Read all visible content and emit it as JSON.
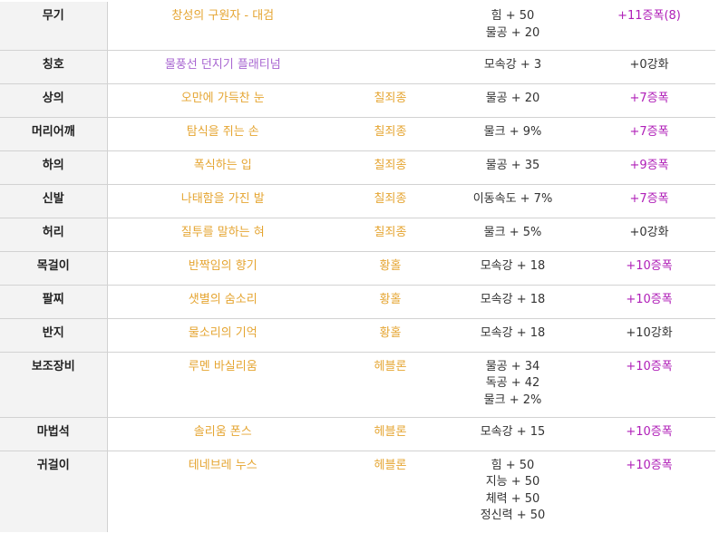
{
  "rows": [
    {
      "slot": "무기",
      "name": "창성의 구원자 - 대검",
      "set": "",
      "stats": [
        "힘 + 50",
        "물공 + 20"
      ],
      "enhance": "+11증폭(8)",
      "enhance_type": "amp",
      "title_color": false
    },
    {
      "slot": "칭호",
      "name": "물풍선 던지기 플래티넘",
      "set": "",
      "stats": [
        "모속강 + 3"
      ],
      "enhance": "+0강화",
      "enhance_type": "plain",
      "title_color": true
    },
    {
      "slot": "상의",
      "name": "오만에 가득찬 눈",
      "set": "칠죄종",
      "stats": [
        "물공 + 20"
      ],
      "enhance": "+7증폭",
      "enhance_type": "amp",
      "title_color": false
    },
    {
      "slot": "머리어깨",
      "name": "탐식을 쥐는 손",
      "set": "칠죄종",
      "stats": [
        "물크 + 9%"
      ],
      "enhance": "+7증폭",
      "enhance_type": "amp",
      "title_color": false
    },
    {
      "slot": "하의",
      "name": "폭식하는 입",
      "set": "칠죄종",
      "stats": [
        "물공 + 35"
      ],
      "enhance": "+9증폭",
      "enhance_type": "amp",
      "title_color": false
    },
    {
      "slot": "신발",
      "name": "나태함을 가진 발",
      "set": "칠죄종",
      "stats": [
        "이동속도 + 7%"
      ],
      "enhance": "+7증폭",
      "enhance_type": "amp",
      "title_color": false
    },
    {
      "slot": "허리",
      "name": "질투를 말하는 혀",
      "set": "칠죄종",
      "stats": [
        "물크 + 5%"
      ],
      "enhance": "+0강화",
      "enhance_type": "plain",
      "title_color": false
    },
    {
      "slot": "목걸이",
      "name": "반짝임의 향기",
      "set": "황홀",
      "stats": [
        "모속강 + 18"
      ],
      "enhance": "+10증폭",
      "enhance_type": "amp",
      "title_color": false
    },
    {
      "slot": "팔찌",
      "name": "샛별의 숨소리",
      "set": "황홀",
      "stats": [
        "모속강 + 18"
      ],
      "enhance": "+10증폭",
      "enhance_type": "amp",
      "title_color": false
    },
    {
      "slot": "반지",
      "name": "물소리의 기억",
      "set": "황홀",
      "stats": [
        "모속강 + 18"
      ],
      "enhance": "+10강화",
      "enhance_type": "plain",
      "title_color": false
    },
    {
      "slot": "보조장비",
      "name": "루멘 바실리움",
      "set": "헤블론",
      "stats": [
        "물공 + 34",
        "독공 + 42",
        "물크 + 2%"
      ],
      "enhance": "+10증폭",
      "enhance_type": "amp",
      "title_color": false
    },
    {
      "slot": "마법석",
      "name": "솔리움 폰스",
      "set": "헤블론",
      "stats": [
        "모속강 + 15"
      ],
      "enhance": "+10증폭",
      "enhance_type": "amp",
      "title_color": false
    },
    {
      "slot": "귀걸이",
      "name": "테네브레 누스",
      "set": "헤블론",
      "stats": [
        "힘 + 50",
        "지능 + 50",
        "체력 + 50",
        "정신력 + 50"
      ],
      "enhance": "+10증폭",
      "enhance_type": "amp",
      "title_color": false
    }
  ]
}
